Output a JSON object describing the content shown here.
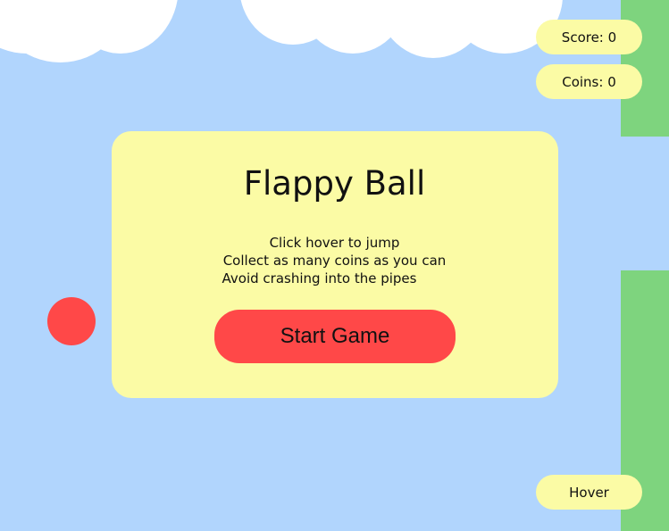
{
  "colors": {
    "sky": "#b1d5fd",
    "cloud": "#ffffff",
    "pipe": "#7ed47e",
    "pill": "#fbfba5",
    "panel": "#fbfba5",
    "ball": "#ff4848",
    "start_button": "#ff4848"
  },
  "hud": {
    "score_label": "Score: 0",
    "coins_label": "Coins: 0",
    "hover_label": "Hover"
  },
  "menu": {
    "title": "Flappy Ball",
    "instructions": [
      "Click hover to jump",
      "Collect as many coins as you can",
      "Avoid crashing into the pipes"
    ],
    "start_label": "Start Game"
  }
}
